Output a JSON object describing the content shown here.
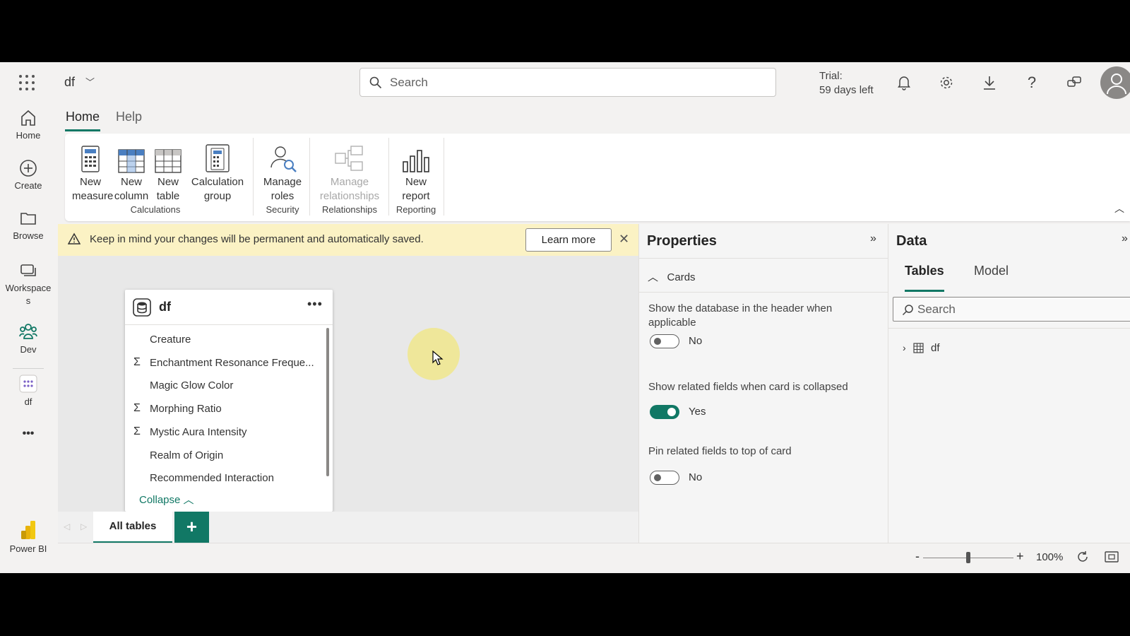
{
  "topbar": {
    "workspace_name": "df",
    "search_placeholder": "Search",
    "trial_line1": "Trial:",
    "trial_line2": "59 days left"
  },
  "rail": {
    "items": [
      {
        "label": "Home",
        "icon": "home-icon"
      },
      {
        "label": "Create",
        "icon": "plus-circle-icon"
      },
      {
        "label": "Browse",
        "icon": "folder-icon"
      },
      {
        "label": "Workspaces",
        "icon": "workspaces-icon"
      },
      {
        "label": "Dev",
        "icon": "people-icon"
      },
      {
        "label": "df",
        "icon": "model-icon"
      }
    ],
    "more_label": "•••",
    "brand_label": "Power BI"
  },
  "ribbon": {
    "tabs": [
      "Home",
      "Help"
    ],
    "buttons": {
      "new_measure": "New\nmeasure",
      "new_column": "New\ncolumn",
      "new_table": "New\ntable",
      "calculation_group": "Calculation\ngroup",
      "manage_roles": "Manage\nroles",
      "manage_relationships": "Manage\nrelationships",
      "new_report": "New\nreport"
    },
    "groups": {
      "calculations": "Calculations",
      "security": "Security",
      "relationships": "Relationships",
      "reporting": "Reporting"
    }
  },
  "banner": {
    "text": "Keep in mind your changes will be permanent and automatically saved.",
    "learn_more": "Learn more"
  },
  "card": {
    "title": "df",
    "fields": [
      {
        "name": "Creature",
        "sum": false
      },
      {
        "name": "Enchantment Resonance Freque...",
        "sum": true
      },
      {
        "name": "Magic Glow Color",
        "sum": false
      },
      {
        "name": "Morphing Ratio",
        "sum": true
      },
      {
        "name": "Mystic Aura Intensity",
        "sum": true
      },
      {
        "name": "Realm of Origin",
        "sum": false
      },
      {
        "name": "Recommended Interaction",
        "sum": false
      }
    ],
    "collapse_label": "Collapse"
  },
  "bottom": {
    "tab_label": "All tables",
    "add_label": "+",
    "zoom": "100%"
  },
  "properties": {
    "title": "Properties",
    "section": "Cards",
    "settings": [
      {
        "label": "Show the database in the header when applicable",
        "state": "No",
        "on": false
      },
      {
        "label": "Show related fields when card is collapsed",
        "state": "Yes",
        "on": true
      },
      {
        "label": "Pin related fields to top of card",
        "state": "No",
        "on": false
      }
    ]
  },
  "data_pane": {
    "title": "Data",
    "tabs": [
      "Tables",
      "Model"
    ],
    "search_placeholder": "Search",
    "table_name": "df"
  },
  "colors": {
    "accent": "#117865",
    "banner": "#fbf2c4",
    "brand": "#f2c811"
  }
}
